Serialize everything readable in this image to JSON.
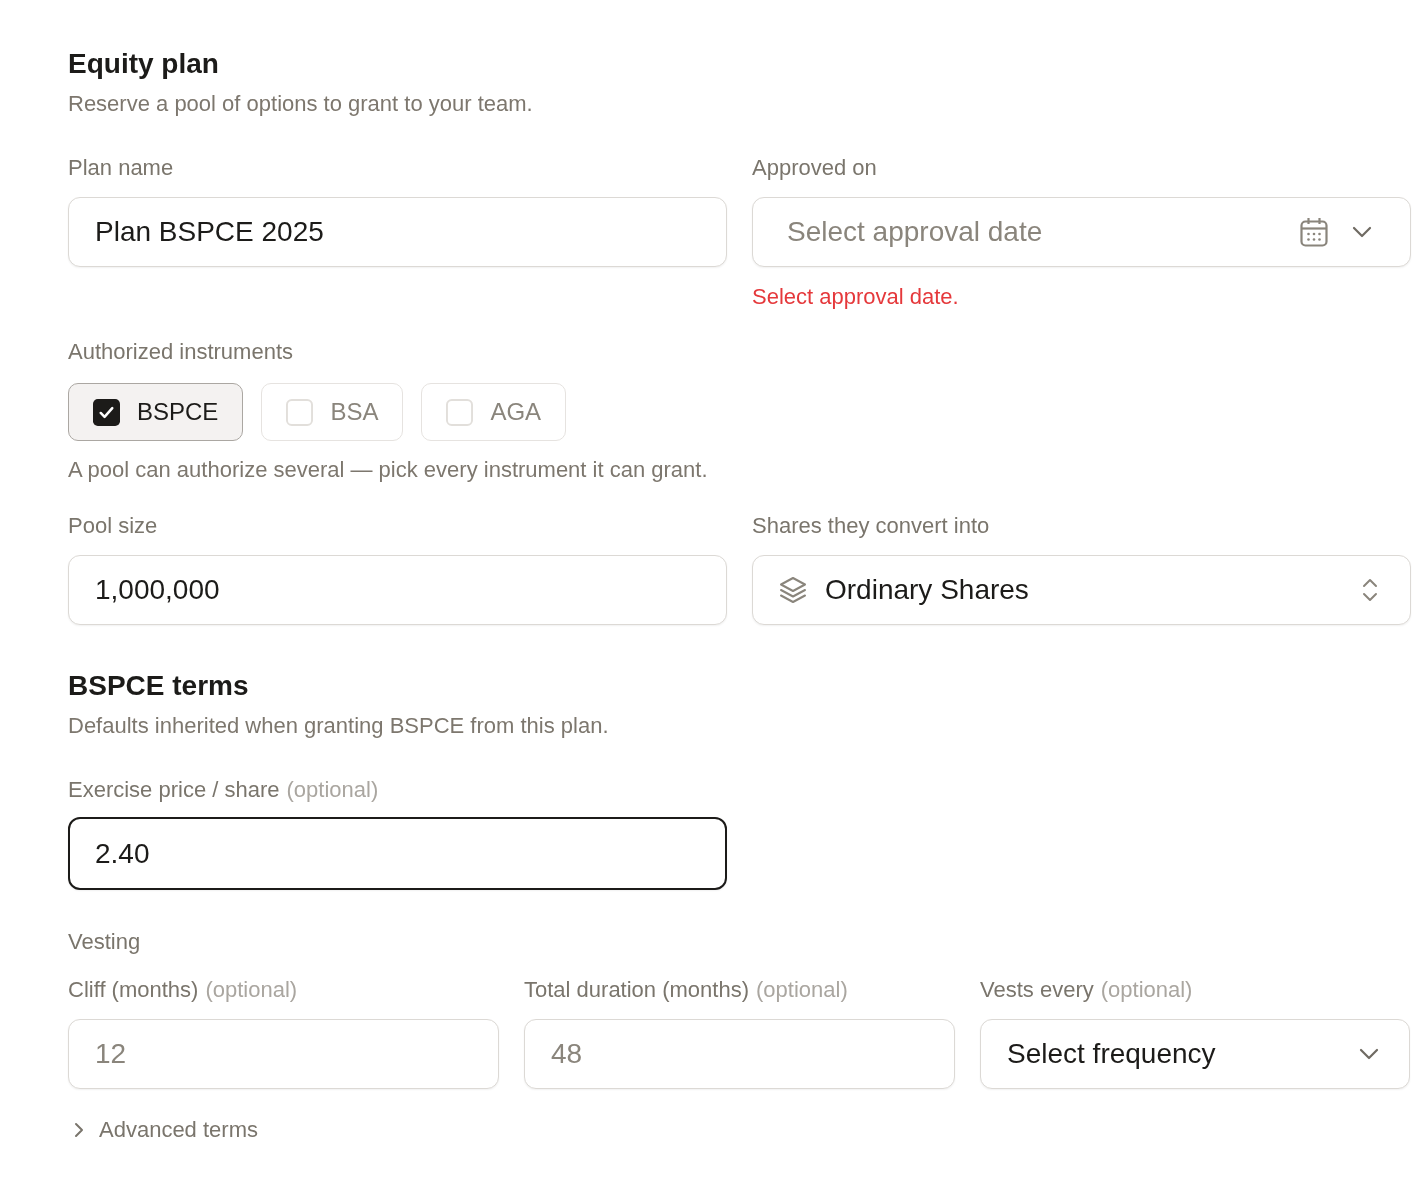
{
  "header": {
    "title": "Equity plan",
    "subtitle": "Reserve a pool of options to grant to your team."
  },
  "plan_row": [
    {
      "kind": "text",
      "label": "Plan name",
      "value": "Plan BSPCE 2025",
      "focused": false
    },
    {
      "kind": "date",
      "label": "Approved on",
      "placeholder": "Select approval date",
      "error": "Select approval date."
    }
  ],
  "instruments": {
    "label": "Authorized instruments",
    "options": [
      {
        "label": "BSPCE",
        "checked": true
      },
      {
        "label": "BSA",
        "checked": false
      },
      {
        "label": "AGA",
        "checked": false
      }
    ],
    "help": "A pool can authorize several — pick every instrument it can grant."
  },
  "pool_row": [
    {
      "kind": "text",
      "label": "Pool size",
      "value": "1,000,000",
      "focused": false
    },
    {
      "kind": "select",
      "label": "Shares they convert into",
      "value": "Ordinary Shares"
    }
  ],
  "terms": {
    "title": "BSPCE terms",
    "subtitle": "Defaults inherited when granting BSPCE from this plan."
  },
  "exercise_row": [
    {
      "kind": "text",
      "label": "Exercise price / share",
      "optional": "(optional)",
      "value": "2.40",
      "focused": true
    }
  ],
  "vesting": {
    "label": "Vesting",
    "fields": [
      {
        "kind": "text",
        "label": "Cliff (months)",
        "optional": "(optional)",
        "placeholder": "12",
        "focused": false
      },
      {
        "kind": "text",
        "label": "Total duration (months)",
        "optional": "(optional)",
        "placeholder": "48",
        "focused": false
      },
      {
        "kind": "dropdown",
        "label": "Vests every",
        "optional": "(optional)",
        "value": "Select frequency"
      }
    ]
  },
  "advanced": {
    "label": "Advanced terms",
    "expanded": false
  }
}
